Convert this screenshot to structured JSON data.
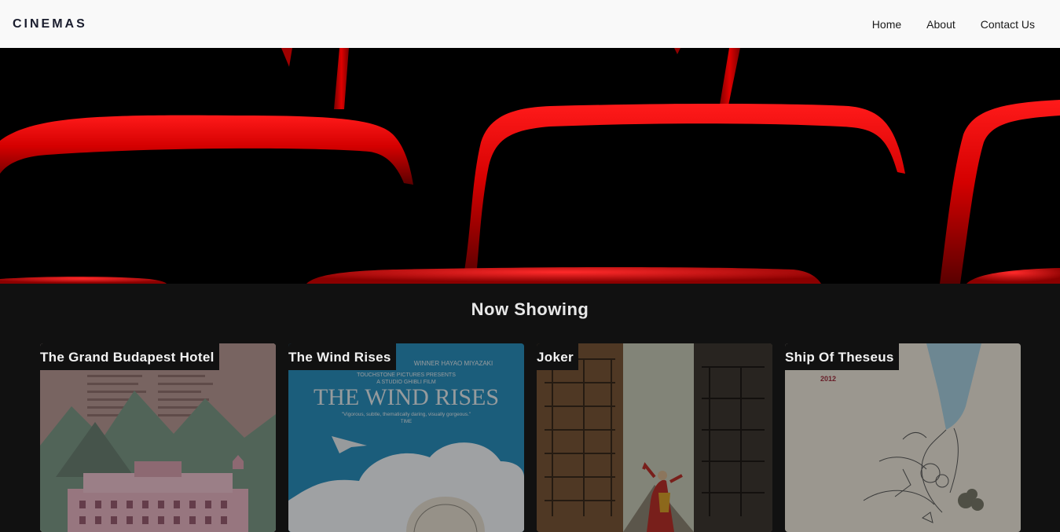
{
  "nav": {
    "brand": "CINEMAS",
    "links": [
      {
        "label": "Home"
      },
      {
        "label": "About"
      },
      {
        "label": "Contact Us"
      }
    ]
  },
  "hero": {
    "image": "red-cinema-seats"
  },
  "section": {
    "title": "Now Showing"
  },
  "movies": [
    {
      "title": "The Grand Budapest Hotel",
      "poster_icon": "grand-budapest-hotel-poster"
    },
    {
      "title": "The Wind Rises",
      "poster_icon": "wind-rises-poster",
      "poster_text": {
        "credit": "WINNER HAYAO MIYAZAKI",
        "presents": "TOUCHSTONE PICTURES PRESENTS",
        "studio": "A STUDIO GHIBLI FILM",
        "headline": "THE WIND RISES",
        "quote": "\"Vigorous, subtle, thematically daring, visually gorgeous.\"",
        "quote_source": "TIME"
      }
    },
    {
      "title": "Joker",
      "poster_icon": "joker-poster"
    },
    {
      "title": "Ship Of Theseus",
      "poster_icon": "ship-of-theseus-poster",
      "poster_text": {
        "year": "2012"
      }
    }
  ],
  "colors": {
    "navbar_bg": "#f9f9f9",
    "page_bg": "#111111",
    "seat_red": "#c40000"
  }
}
